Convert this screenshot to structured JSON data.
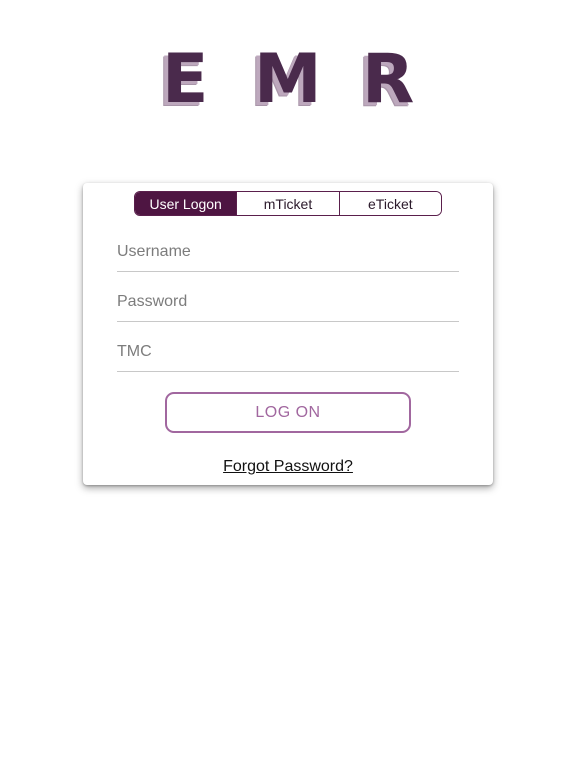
{
  "logo": {
    "letters": [
      "E",
      "M",
      "R"
    ],
    "color": "#4a2a4c",
    "shadow_color": "#bda8bd"
  },
  "tabs": [
    {
      "label": "User Logon",
      "active": true
    },
    {
      "label": "mTicket",
      "active": false
    },
    {
      "label": "eTicket",
      "active": false
    }
  ],
  "form": {
    "username": {
      "placeholder": "Username",
      "value": ""
    },
    "password": {
      "placeholder": "Password",
      "value": ""
    },
    "tmc": {
      "placeholder": "TMC",
      "value": ""
    }
  },
  "logon_button": {
    "label": "LOG ON"
  },
  "forgot_link": {
    "label": "Forgot Password?"
  },
  "colors": {
    "accent": "#4e1542",
    "button_outline": "#a1679f",
    "divider": "#c8c8c8"
  }
}
